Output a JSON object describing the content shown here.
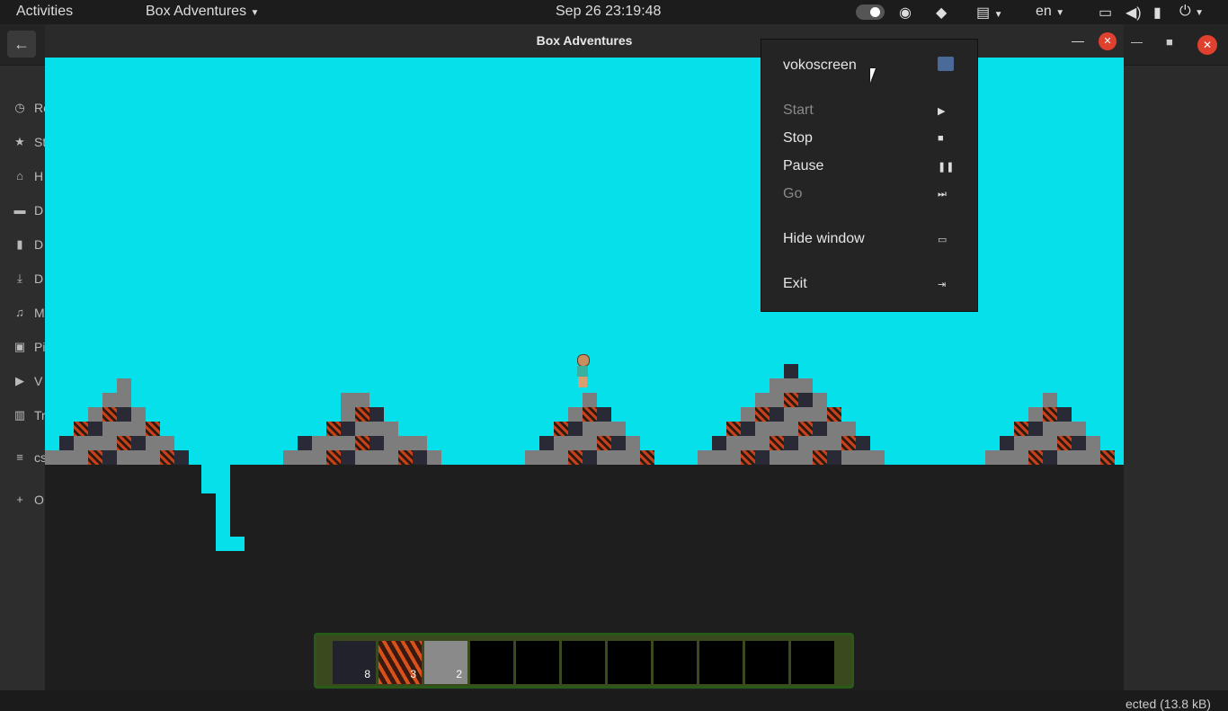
{
  "topbar": {
    "activities": "Activities",
    "app_name": "Box Adventures",
    "clock": "Sep 26  23:19:48",
    "lang": "en"
  },
  "background_window": {
    "sidebar": [
      {
        "icon": "clock-icon",
        "glyph": "◷",
        "label": "Re"
      },
      {
        "icon": "star-icon",
        "glyph": "★",
        "label": "St"
      },
      {
        "icon": "home-icon",
        "glyph": "⌂",
        "label": "H"
      },
      {
        "icon": "desktop-icon",
        "glyph": "▬",
        "label": "D"
      },
      {
        "icon": "document-icon",
        "glyph": "▮",
        "label": "D"
      },
      {
        "icon": "download-icon",
        "glyph": "⤓",
        "label": "D"
      },
      {
        "icon": "music-icon",
        "glyph": "♫",
        "label": "M"
      },
      {
        "icon": "pictures-icon",
        "glyph": "▣",
        "label": "Pi"
      },
      {
        "icon": "videos-icon",
        "glyph": "▶",
        "label": "V"
      },
      {
        "icon": "trash-icon",
        "glyph": "▥",
        "label": "Tr"
      },
      {
        "icon": "network-icon",
        "glyph": "≡",
        "label": "cs"
      },
      {
        "icon": "plus-icon",
        "glyph": "+",
        "label": "O"
      }
    ],
    "status_text": "ected  (13.8 kB)"
  },
  "game_window": {
    "title": "Box Adventures",
    "hotbar": [
      {
        "type": "obsidian",
        "count": "8"
      },
      {
        "type": "lava",
        "count": "3"
      },
      {
        "type": "stone",
        "count": "2"
      },
      {
        "type": "empty",
        "count": ""
      },
      {
        "type": "empty",
        "count": ""
      },
      {
        "type": "empty",
        "count": ""
      },
      {
        "type": "empty",
        "count": ""
      },
      {
        "type": "empty",
        "count": ""
      },
      {
        "type": "empty",
        "count": ""
      },
      {
        "type": "empty",
        "count": ""
      },
      {
        "type": "empty",
        "count": ""
      }
    ]
  },
  "tray_menu": {
    "header": "vokoscreen",
    "items": [
      {
        "label": "Start",
        "icon": "▶",
        "disabled": true
      },
      {
        "label": "Stop",
        "icon": "■",
        "disabled": false
      },
      {
        "label": "Pause",
        "icon": "❚❚",
        "disabled": false
      },
      {
        "label": "Go",
        "icon": "⏭",
        "disabled": true
      },
      {
        "label": "Hide window",
        "icon": "▭",
        "disabled": false
      },
      {
        "label": "Exit",
        "icon": "⇥",
        "disabled": false
      }
    ]
  },
  "colors": {
    "sky": "#05e0ea",
    "ground": "#1e1e1e",
    "stone": "#7d7d7d",
    "lava": "#c8401a",
    "obsidian": "#2a2a36",
    "close_red": "#e0402e"
  }
}
